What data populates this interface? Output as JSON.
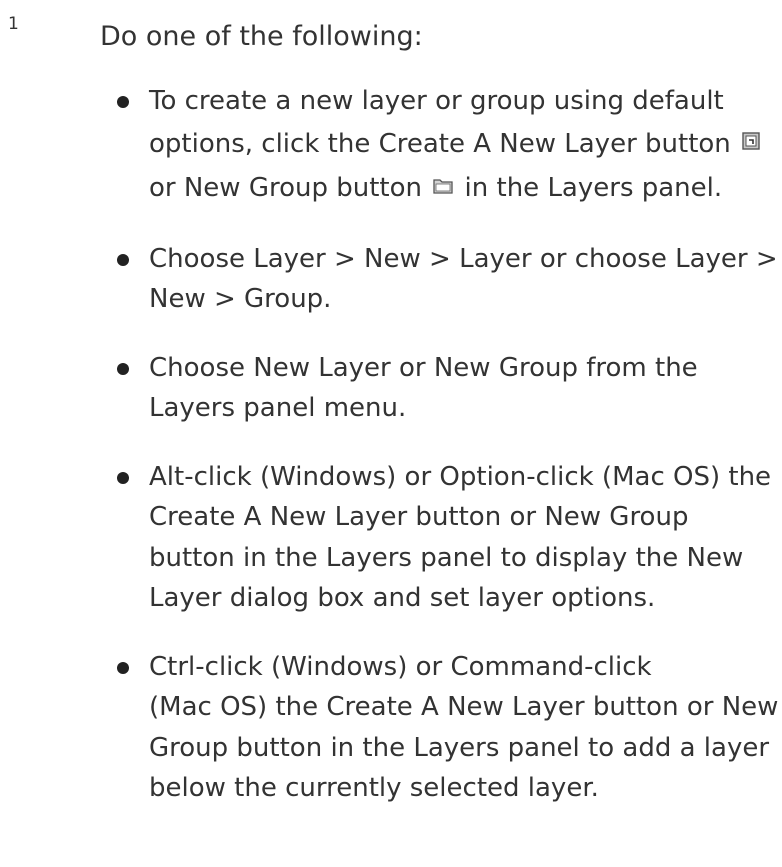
{
  "step": {
    "number": "1",
    "intro": "Do one of the following:"
  },
  "bullets": [
    {
      "lines": [
        "To create a new layer or group using default",
        "options, click the Create A New Layer button",
        "or New Group button",
        "in the Layers panel."
      ],
      "icons": [
        "new-layer-icon",
        "new-group-folder-icon"
      ]
    },
    {
      "lines": [
        "Choose Layer > New > Layer or choose Layer >",
        "New > Group."
      ]
    },
    {
      "lines": [
        "Choose New Layer or New Group from the",
        "Layers panel menu."
      ]
    },
    {
      "lines": [
        "Alt-click (Windows) or Option-click (Mac OS) the",
        "Create A New Layer button or New Group",
        "button in the Layers panel to display the New",
        "Layer dialog box and set layer options."
      ]
    },
    {
      "lines": [
        "Ctrl-click (Windows) or Command-click",
        "(Mac OS) the Create A New Layer button or New",
        "Group button in the Layers panel to add a layer",
        "below the currently selected layer."
      ]
    }
  ]
}
